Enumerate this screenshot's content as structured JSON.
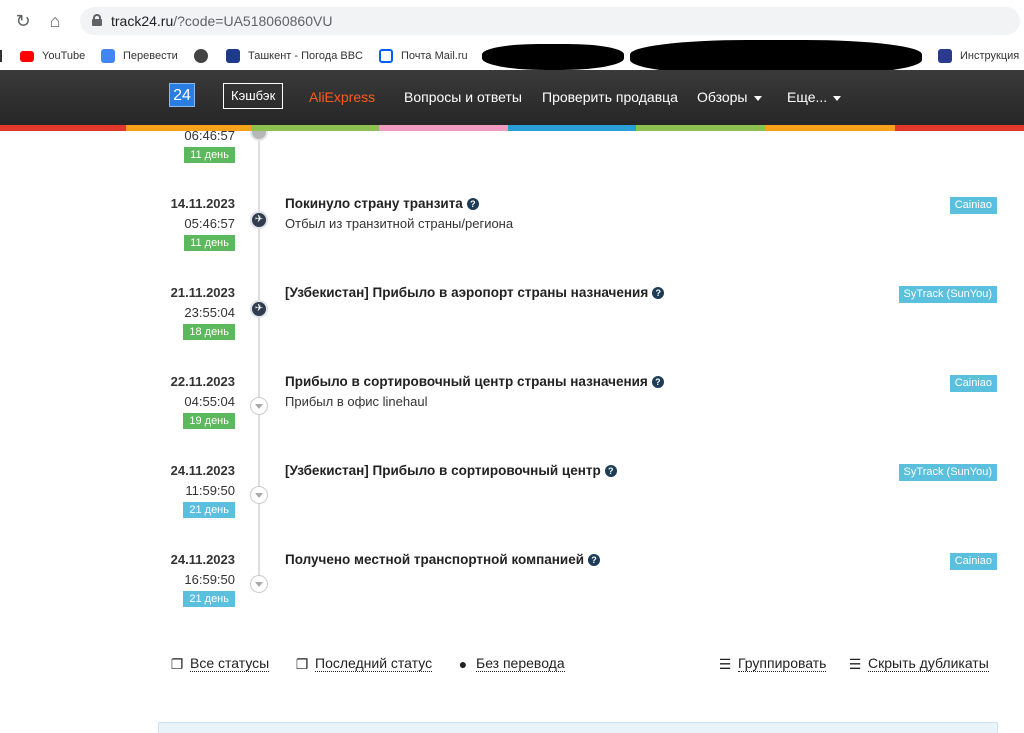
{
  "browser": {
    "url_host": "track24.ru",
    "url_rest": "/?code=UA518060860VU",
    "bookmarks": [
      {
        "label": "YouTube",
        "color": "#ff0000"
      },
      {
        "label": "Перевести",
        "color": "#4285f4"
      },
      {
        "label": "",
        "color": "#444444"
      },
      {
        "label": "Ташкент - Погода BBC",
        "color": "#1e3a8a"
      },
      {
        "label": "Почта Mail.ru",
        "color": "#005ff9"
      },
      {
        "label": "Инструкция",
        "color": "#2b3a8f"
      }
    ]
  },
  "header": {
    "logo": "24",
    "cashback": "Кэшбэк",
    "nav": [
      "AliExpress",
      "Вопросы и ответы",
      "Проверить продавца",
      "Обзоры",
      "Еще..."
    ]
  },
  "events": [
    {
      "date": "",
      "time": "06:46:57",
      "day": "11 день",
      "day_color": "green",
      "title": "",
      "desc": "",
      "source": "",
      "dot": "gray"
    },
    {
      "date": "14.11.2023",
      "time": "05:46:57",
      "day": "11 день",
      "day_color": "green",
      "title": "Покинуло страну транзита",
      "desc": "Отбыл из транзитной страны/региона",
      "source": "Cainiao",
      "dot": "dark"
    },
    {
      "date": "21.11.2023",
      "time": "23:55:04",
      "day": "18 день",
      "day_color": "green",
      "title": "[Узбекистан] Прибыло в аэропорт страны назначения",
      "desc": "",
      "source": "SyTrack (SunYou)",
      "dot": "dark"
    },
    {
      "date": "22.11.2023",
      "time": "04:55:04",
      "day": "19 день",
      "day_color": "green",
      "title": "Прибыло в сортировочный центр страны назначения",
      "desc": "Прибыл в офис linehaul",
      "source": "Cainiao",
      "dot": "light"
    },
    {
      "date": "24.11.2023",
      "time": "11:59:50",
      "day": "21 день",
      "day_color": "blue",
      "title": "[Узбекистан] Прибыло в сортировочный центр",
      "desc": "",
      "source": "SyTrack (SunYou)",
      "dot": "light"
    },
    {
      "date": "24.11.2023",
      "time": "16:59:50",
      "day": "21 день",
      "day_color": "blue",
      "title": "Получено местной транспортной компанией",
      "desc": "",
      "source": "Cainiao",
      "dot": "light"
    }
  ],
  "bottom_links": {
    "all_statuses": "Все статусы",
    "last_status": "Последний статус",
    "no_translation": "Без перевода",
    "group": "Группировать",
    "hide_duplicates": "Скрыть дубликаты"
  },
  "colors": {
    "day_green": "#5cb85c",
    "day_blue": "#5bc0de",
    "source_badge": "#5bc0de",
    "stripe": [
      "#e2372b",
      "#f7a21b",
      "#8cc152",
      "#f49ac1",
      "#2a9fd6",
      "#8cc152",
      "#f7a21b",
      "#e2372b"
    ]
  }
}
